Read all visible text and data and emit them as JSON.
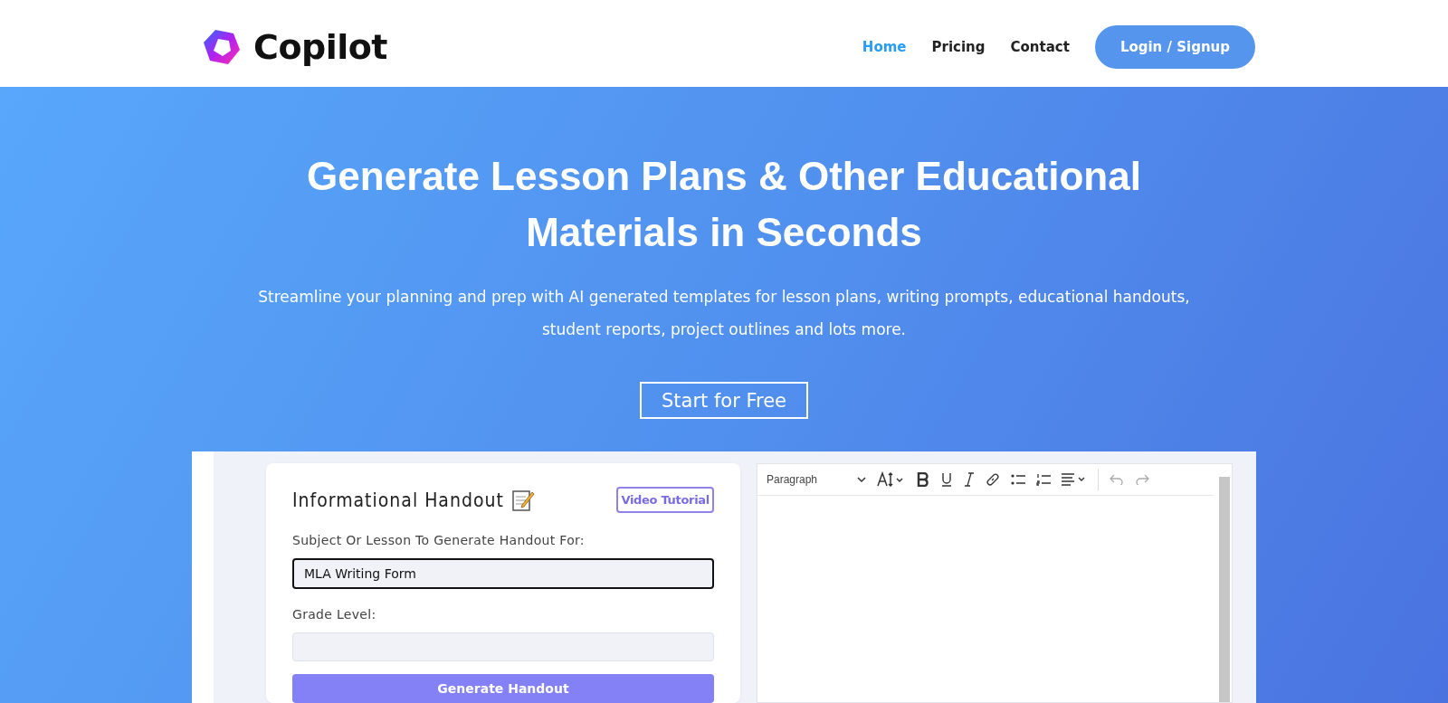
{
  "header": {
    "logo": "Copilot",
    "nav": [
      {
        "label": "Home",
        "selected": true
      },
      {
        "label": "Pricing",
        "selected": false
      },
      {
        "label": "Contact",
        "selected": false
      }
    ],
    "cta": "Login / Signup"
  },
  "hero": {
    "title": "Generate Lesson Plans & Other Educational Materials in Seconds",
    "subtitle": "Streamline your planning and prep with AI generated templates for lesson plans, writing prompts, educational handouts, student reports, project outlines and lots more.",
    "button": "Start for Free"
  },
  "demo": {
    "form": {
      "title": "Informational Handout",
      "tutorial_button": "Video Tutorial",
      "fields": [
        {
          "label": "Subject Or Lesson To Generate Handout For:",
          "value": "MLA Writing Form",
          "focused": true
        },
        {
          "label": "Grade Level:",
          "focused": false
        }
      ],
      "submit": "Generate Handout"
    },
    "editor": {
      "block_format": "Paragraph"
    }
  }
}
